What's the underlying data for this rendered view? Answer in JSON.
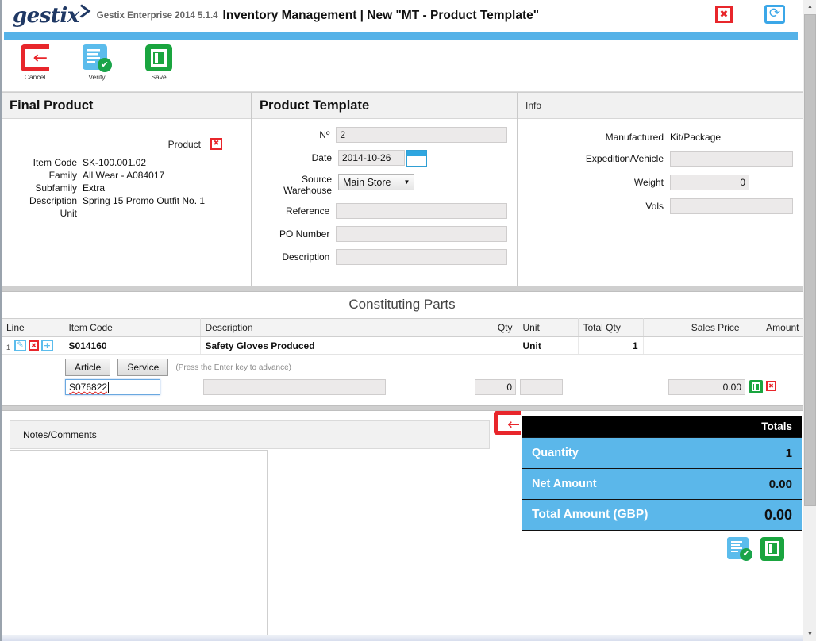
{
  "titlebar": {
    "logo_text": "gestix",
    "app_version": "Gestix Enterprise 2014 5.1.4",
    "document_title": "Inventory Management | New \"MT - Product Template\"",
    "close_label": "✖",
    "refresh_name": "refresh-icon"
  },
  "toolbar": {
    "items": [
      {
        "label": "Cancel",
        "icon": "back-arrow-icon"
      },
      {
        "label": "Verify",
        "icon": "verify-document-icon"
      },
      {
        "label": "Save",
        "icon": "save-icon"
      }
    ]
  },
  "final_product": {
    "header": "Final Product",
    "product_label": "Product",
    "product_clear_label": "✖",
    "fields": [
      {
        "label": "Item Code",
        "value": "SK-100.001.02"
      },
      {
        "label": "Family",
        "value": "All Wear - A084017"
      },
      {
        "label": "Subfamily",
        "value": "Extra"
      },
      {
        "label": "Description",
        "value": "Spring 15 Promo Outfit No. 1"
      },
      {
        "label": "Unit",
        "value": ""
      }
    ]
  },
  "product_template": {
    "header": "Product Template",
    "no_label": "Nº",
    "no_value": "2",
    "date_label": "Date",
    "date_value": "2014-10-26",
    "source_warehouse_label_line1": "Source",
    "source_warehouse_label_line2": "Warehouse",
    "source_warehouse_value": "Main Store",
    "source_warehouse_caret": "▼",
    "reference_label": "Reference",
    "reference_value": "",
    "po_number_label": "PO Number",
    "po_number_value": "",
    "description_label": "Description",
    "description_value": ""
  },
  "info": {
    "header": "Info",
    "manufactured_label": "Manufactured",
    "manufactured_value": "Kit/Package",
    "expedition_label": "Expedition/Vehicle",
    "expedition_value": "",
    "weight_label": "Weight",
    "weight_value": "0",
    "vols_label": "Vols",
    "vols_value": ""
  },
  "constituting_parts": {
    "title": "Constituting Parts",
    "columns": [
      "Line",
      "Item Code",
      "Description",
      "Qty",
      "Unit",
      "Total Qty",
      "Sales Price",
      "Amount"
    ],
    "rows": [
      {
        "line": "1",
        "item_code": "S014160",
        "description": "Safety Gloves Produced",
        "qty": "",
        "unit": "Unit",
        "total_qty": "1",
        "sales_price": "",
        "amount": ""
      }
    ],
    "type_buttons": [
      "Article",
      "Service"
    ],
    "hint": "(Press the Enter key to advance)",
    "entry": {
      "item_code_value": "S076822",
      "description_value": "",
      "qty_value": "0",
      "unit_value": "",
      "sales_price_value": "0.00",
      "confirm_label": "save-icon",
      "cancel_label": "✖"
    }
  },
  "notes": {
    "header": "Notes/Comments",
    "value": ""
  },
  "totals": {
    "header": "Totals",
    "rows": [
      {
        "label": "Quantity",
        "value": "1"
      },
      {
        "label": "Net Amount",
        "value": "0.00"
      },
      {
        "label": "Total Amount (GBP)",
        "value": "0.00"
      }
    ]
  },
  "colors": {
    "accent_blue": "#55b2e8",
    "totals_blue": "#5bb7ea",
    "danger_red": "#e8262b",
    "success_green": "#1aa53f"
  }
}
